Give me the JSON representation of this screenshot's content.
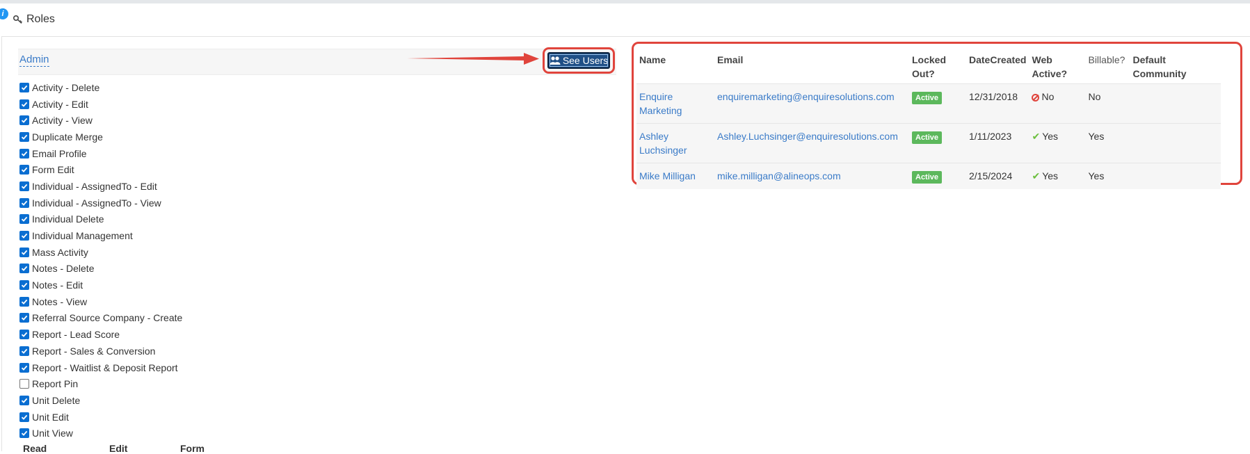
{
  "header": {
    "title": "Roles",
    "info_icon": "i"
  },
  "role": {
    "name": "Admin",
    "see_users_label": "See Users"
  },
  "permissions": [
    {
      "label": "Activity - Delete",
      "checked": true
    },
    {
      "label": "Activity - Edit",
      "checked": true
    },
    {
      "label": "Activity - View",
      "checked": true
    },
    {
      "label": "Duplicate Merge",
      "checked": true
    },
    {
      "label": "Email Profile",
      "checked": true
    },
    {
      "label": "Form Edit",
      "checked": true
    },
    {
      "label": "Individual - AssignedTo - Edit",
      "checked": true
    },
    {
      "label": "Individual - AssignedTo - View",
      "checked": true
    },
    {
      "label": "Individual Delete",
      "checked": true
    },
    {
      "label": "Individual Management",
      "checked": true
    },
    {
      "label": "Mass Activity",
      "checked": true
    },
    {
      "label": "Notes - Delete",
      "checked": true
    },
    {
      "label": "Notes - Edit",
      "checked": true
    },
    {
      "label": "Notes - View",
      "checked": true
    },
    {
      "label": "Referral Source Company - Create",
      "checked": true
    },
    {
      "label": "Report - Lead Score",
      "checked": true
    },
    {
      "label": "Report - Sales & Conversion",
      "checked": true
    },
    {
      "label": "Report - Waitlist & Deposit Report",
      "checked": true
    },
    {
      "label": "Report Pin",
      "checked": false
    },
    {
      "label": "Unit Delete",
      "checked": true
    },
    {
      "label": "Unit Edit",
      "checked": true
    },
    {
      "label": "Unit View",
      "checked": true
    }
  ],
  "footer_columns": [
    "Read",
    "Edit",
    "Form"
  ],
  "users_table": {
    "headers": {
      "name": "Name",
      "email": "Email",
      "locked_out_1": "Locked",
      "locked_out_2": "Out?",
      "date_created": "DateCreated",
      "web_active_1": "Web",
      "web_active_2": "Active?",
      "billable": "Billable?",
      "default_community_1": "Default",
      "default_community_2": "Community"
    },
    "rows": [
      {
        "name_1": "Enquire",
        "name_2": "Marketing",
        "email": "enquiremarketing@enquiresolutions.com",
        "locked_out": "Active",
        "date_created": "12/31/2018",
        "web_active": "No",
        "web_active_icon": "ban-icon",
        "billable": "No",
        "default_community": ""
      },
      {
        "name_1": "Ashley",
        "name_2": "Luchsinger",
        "email": "Ashley.Luchsinger@enquiresolutions.com",
        "locked_out": "Active",
        "date_created": "1/11/2023",
        "web_active": "Yes",
        "web_active_icon": "check-icon",
        "billable": "Yes",
        "default_community": ""
      },
      {
        "name_1": "Mike Milligan",
        "name_2": "",
        "email": "mike.milligan@alineops.com",
        "locked_out": "Active",
        "date_created": "2/15/2024",
        "web_active": "Yes",
        "web_active_icon": "check-icon",
        "billable": "Yes",
        "default_community": ""
      }
    ]
  },
  "colors": {
    "accent": "#3a7bc8",
    "highlight": "#e0443c",
    "badge": "#5cb85c",
    "button": "#1f4f86"
  }
}
